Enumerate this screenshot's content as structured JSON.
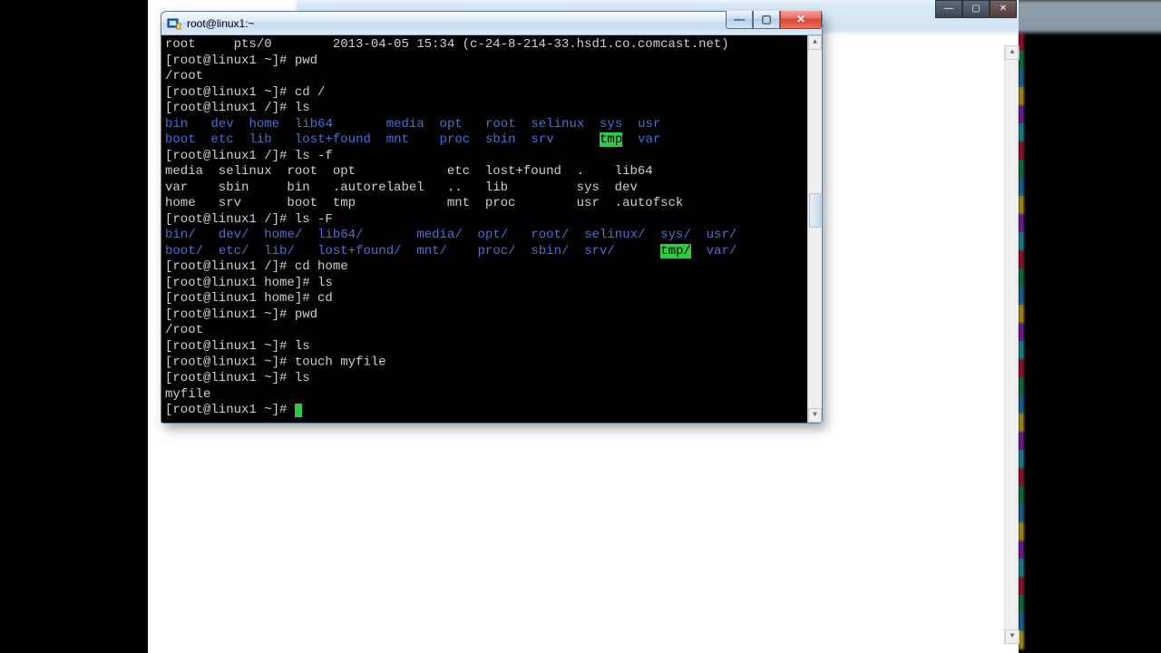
{
  "bg_window": {
    "controls": {
      "min": "—",
      "max": "▢",
      "close": "✕"
    }
  },
  "terminal": {
    "title": "root@linux1:~",
    "controls": {
      "min": "—",
      "max": "▢",
      "close": "✕"
    },
    "scroll": {
      "up": "▲",
      "down": "▼"
    },
    "lines": {
      "l0": "root     pts/0        2013-04-05 15:34 (c-24-8-214-33.hsd1.co.comcast.net)",
      "p_home": "[root@linux1 ~]# ",
      "p_root": "[root@linux1 /]# ",
      "p_homed": "[root@linux1 home]# ",
      "cmd_pwd": "pwd",
      "out_pwd": "/root",
      "cmd_cdroot": "cd /",
      "cmd_ls": "ls",
      "cmd_lsf": "ls -f",
      "cmd_lsF": "ls -F",
      "cmd_cdhome": "cd home",
      "cmd_cd": "cd",
      "cmd_touch": "touch myfile",
      "out_myfile": "myfile",
      "ls_row1": {
        "c0": "bin",
        "c1": "dev",
        "c2": "home",
        "c3": "lib64",
        "c4": "media",
        "c5": "opt",
        "c6": "root",
        "c7": "selinux",
        "c8": "sys",
        "c9": "usr"
      },
      "ls_row2": {
        "c0": "boot",
        "c1": "etc",
        "c2": "lib",
        "c3": "lost+found",
        "c4": "mnt",
        "c5": "proc",
        "c6": "sbin",
        "c7": "srv",
        "c8": "tmp",
        "c9": "var"
      },
      "lsf_r1": "media  selinux  root  opt            etc  lost+found  .    lib64",
      "lsf_r2": "var    sbin     bin   .autorelabel   ..   lib         sys  dev",
      "lsf_r3": "home   srv      boot  tmp            mnt  proc        usr  .autofsck",
      "lsF_row1": {
        "c0": "bin/",
        "c1": "dev/",
        "c2": "home/",
        "c3": "lib64/",
        "c4": "media/",
        "c5": "opt/",
        "c6": "root/",
        "c7": "selinux/",
        "c8": "sys/",
        "c9": "usr/"
      },
      "lsF_row2": {
        "c0": "boot/",
        "c1": "etc/",
        "c2": "lib/",
        "c3": "lost+found/",
        "c4": "mnt/",
        "c5": "proc/",
        "c6": "sbin/",
        "c7": "srv/",
        "c8": "tmp/",
        "c9": "var/"
      }
    }
  }
}
